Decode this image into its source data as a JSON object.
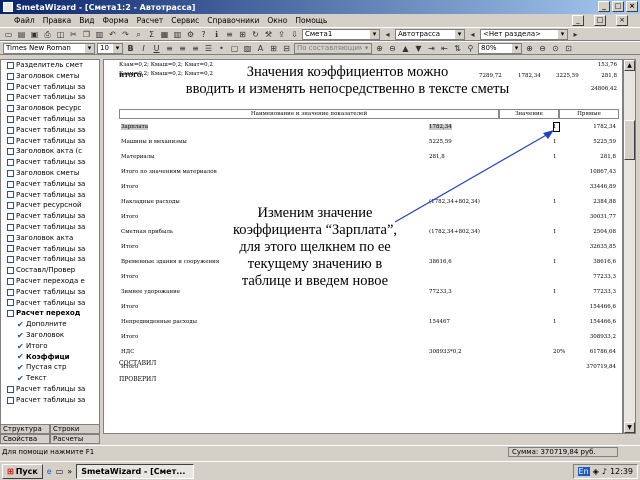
{
  "window": {
    "title": "SmetaWizard - [Смета1:2 - Автотрасса]",
    "min": "_",
    "max": "□",
    "close": "×"
  },
  "menu": [
    "Файл",
    "Правка",
    "Вид",
    "Форма",
    "Расчет",
    "Сервис",
    "Справочники",
    "Окно",
    "Помощь"
  ],
  "toolbar1": {
    "combo_smeta": "Смета1",
    "combo_object": "Автотрасса",
    "combo_section": "<Нет раздела>"
  },
  "toolbar2": {
    "font": "Times New Roman",
    "size": "10",
    "style": "По составляющим",
    "zoom": "80%"
  },
  "sidebar": {
    "items": [
      {
        "label": "Разделитель смет",
        "type": "box",
        "bold": false
      },
      {
        "label": "Заголовок сметы",
        "type": "box",
        "bold": false
      },
      {
        "label": "Расчет таблицы за",
        "type": "box",
        "bold": false
      },
      {
        "label": "Расчет таблицы за",
        "type": "box",
        "bold": false
      },
      {
        "label": "Заголовок ресурс",
        "type": "box",
        "bold": false
      },
      {
        "label": "Расчет таблицы за",
        "type": "box",
        "bold": false
      },
      {
        "label": "Расчет таблицы за",
        "type": "box",
        "bold": false
      },
      {
        "label": "Расчет таблицы за",
        "type": "box",
        "bold": false
      },
      {
        "label": "Заголовок акта (с",
        "type": "box",
        "bold": false
      },
      {
        "label": "Расчет таблицы за",
        "type": "box",
        "bold": false
      },
      {
        "label": "Заголовок сметы",
        "type": "box",
        "bold": false
      },
      {
        "label": "Расчет таблицы за",
        "type": "box",
        "bold": false
      },
      {
        "label": "Расчет таблицы за",
        "type": "box",
        "bold": false
      },
      {
        "label": "Расчет ресурсной",
        "type": "box",
        "bold": false
      },
      {
        "label": "Расчет таблицы за",
        "type": "box",
        "bold": false
      },
      {
        "label": "Расчет таблицы за",
        "type": "box",
        "bold": false
      },
      {
        "label": "Заголовок акта",
        "type": "box",
        "bold": false
      },
      {
        "label": "Расчет таблицы за",
        "type": "box",
        "bold": false
      },
      {
        "label": "Расчет таблицы за",
        "type": "box",
        "bold": false
      },
      {
        "label": "Составл/Провер",
        "type": "box",
        "bold": false
      },
      {
        "label": "Расчет перехода е",
        "type": "box",
        "bold": false
      },
      {
        "label": "Расчет таблицы за",
        "type": "box",
        "bold": false
      },
      {
        "label": "Расчет таблицы за",
        "type": "box",
        "bold": false
      },
      {
        "label": "Расчет переход",
        "type": "box",
        "bold": true
      },
      {
        "label": "Дополните",
        "type": "check",
        "bold": false
      },
      {
        "label": "Заголовок",
        "type": "check",
        "bold": false
      },
      {
        "label": "Итого",
        "type": "check",
        "bold": false
      },
      {
        "label": "Коэффици",
        "type": "check",
        "bold": true
      },
      {
        "label": "Пустая стр",
        "type": "check",
        "bold": false
      },
      {
        "label": "Текст",
        "type": "check",
        "bold": false
      },
      {
        "label": "Расчет таблицы за",
        "type": "box",
        "bold": false
      },
      {
        "label": "Расчет таблицы за",
        "type": "box",
        "bold": false
      }
    ],
    "tabs1": [
      "Структура",
      "Строки"
    ],
    "tabs2": [
      "Свойства",
      "Расчеты"
    ]
  },
  "doc": {
    "line1": "Кзам=0,2; Кмаш=0,2; Кмат=0,2",
    "line1_val": "153,76",
    "line2": "Кзам=0,2; Кмаш=0,2; Кмат=0,2",
    "itogo_label": "ИТОГО:",
    "itogo_vals": [
      "7289,72",
      "1782,34",
      "3225,59",
      "281,8"
    ],
    "itogo_val2": "24806,42",
    "header": {
      "name": "Наименование и значение показателей",
      "value": "Значение",
      "total": "Прямые"
    },
    "rows": [
      {
        "name": "Зарплата",
        "expr": "1782,34",
        "k": "1",
        "total": "1782,34",
        "hl": true
      },
      {
        "name": "Машины и механизмы",
        "expr": "5225,59",
        "k": "1",
        "total": "5225,59",
        "hl": false
      },
      {
        "name": "Материалы",
        "expr": "281,8",
        "k": "1",
        "total": "281,8",
        "hl": false
      },
      {
        "name": "Итого по значениям материалов",
        "expr": "",
        "k": "",
        "total": "10867,43",
        "hl": false
      },
      {
        "name": "Итого",
        "expr": "",
        "k": "",
        "total": "33446,89",
        "hl": false
      },
      {
        "name": "Накладные расходы",
        "expr": "(1782,34+802,34)",
        "k": "1",
        "total": "2384,88",
        "hl": false
      },
      {
        "name": "Итого",
        "expr": "",
        "k": "",
        "total": "30031,77",
        "hl": false
      },
      {
        "name": "Сметная прибыль",
        "expr": "(1782,34+802,34)",
        "k": "1",
        "total": "2504,08",
        "hl": false
      },
      {
        "name": "Итого",
        "expr": "",
        "k": "",
        "total": "32635,85",
        "hl": false
      },
      {
        "name": "Временные здания и сооружения",
        "expr": "38616,6",
        "k": "1",
        "total": "38616,6",
        "hl": false
      },
      {
        "name": "Итого",
        "expr": "",
        "k": "",
        "total": "77233,3",
        "hl": false
      },
      {
        "name": "Зимнее удорожание",
        "expr": "77233,3",
        "k": "1",
        "total": "77233,3",
        "hl": false
      },
      {
        "name": "Итого",
        "expr": "",
        "k": "",
        "total": "154466,6",
        "hl": false
      },
      {
        "name": "Непредвиденные расходы",
        "expr": "154467",
        "k": "1",
        "total": "154466,6",
        "hl": false
      },
      {
        "name": "Итого",
        "expr": "",
        "k": "",
        "total": "308933,2",
        "hl": false
      },
      {
        "name": "НДС",
        "expr": "308933*0,2",
        "k": "20%",
        "total": "61786,64",
        "hl": false
      },
      {
        "name": "Итого",
        "expr": "",
        "k": "",
        "total": "370719,84",
        "hl": false
      }
    ],
    "sostavil": "СОСТАВИЛ",
    "proveril": "ПРОВЕРИЛ"
  },
  "callouts": {
    "top": [
      "Значения коэффициентов можно",
      "вводить и изменять непосредственно в тексте сметы"
    ],
    "middle": [
      "Изменим значение",
      "коэффициента “Зарплата”,",
      "для этого щелкнем по ее",
      "текущему значению в",
      "таблице и введем новое"
    ]
  },
  "status": {
    "hint": "Для помощи нажмите F1",
    "sum": "Сумма: 370719,84 руб."
  },
  "taskbar": {
    "start": "Пуск",
    "task": "SmetaWizard - [Смет...",
    "clock": "12:39",
    "lang": "En"
  },
  "colors": {
    "title_start": "#0a246a",
    "title_end": "#a6caf0",
    "arrow": "#2040c0",
    "highlight": "#c8c8c8"
  }
}
